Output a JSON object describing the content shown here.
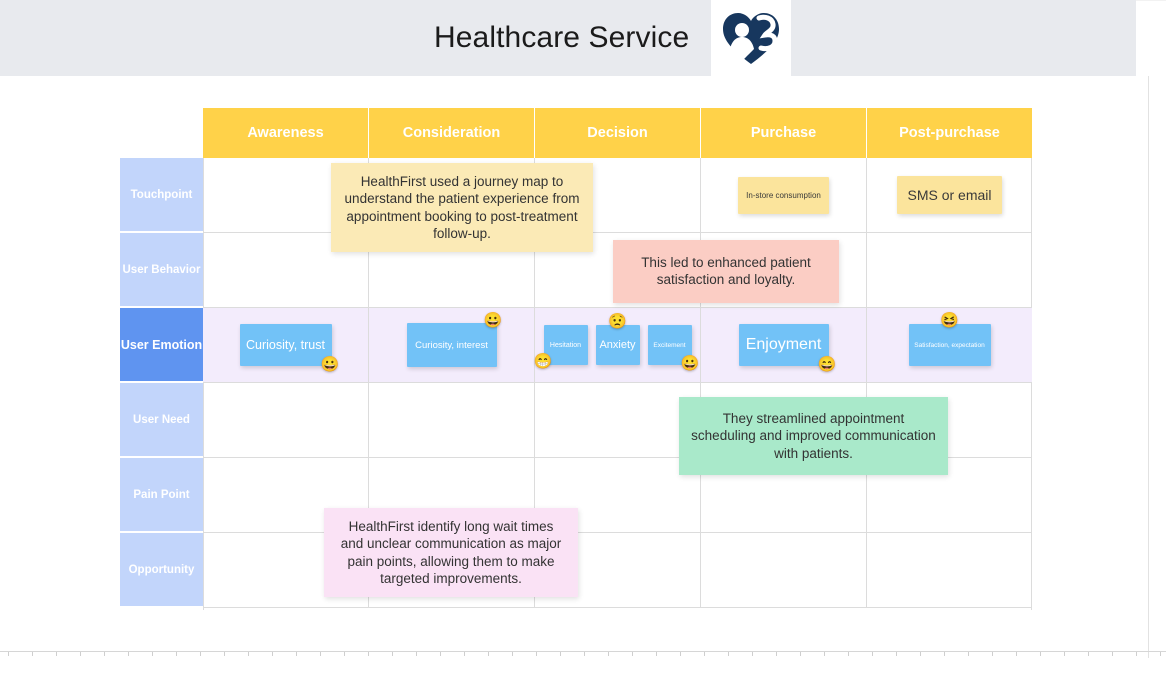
{
  "header": {
    "title": "Healthcare Service",
    "logo_icon": "heart-person-s-logo"
  },
  "journey_map": {
    "columns": [
      "Awareness",
      "Consideration",
      "Decision",
      "Purchase",
      "Post-purchase"
    ],
    "rows": [
      {
        "label": "Touchpoint"
      },
      {
        "label": "User  Behavior"
      },
      {
        "label": "User  Emotion",
        "active": true
      },
      {
        "label": "User  Need"
      },
      {
        "label": "Pain  Point"
      },
      {
        "label": "Opportunity"
      }
    ],
    "cell_notes": {
      "touchpoint_purchase": "In-store consumption",
      "touchpoint_postpurchase": "SMS  or email",
      "emotion_awareness": "Curiosity, trust",
      "emotion_consideration": "Curiosity, interest",
      "emotion_decision_1": "Hesitation",
      "emotion_decision_2": "Anxiety",
      "emotion_decision_3": "Excitement",
      "emotion_purchase": "Enjoyment",
      "emotion_postpurchase": "Satisfaction, expectation"
    },
    "emojis": {
      "emotion_awareness": "😀",
      "emotion_consideration": "😀",
      "emotion_decision_1": "😁",
      "emotion_decision_2": "😟",
      "emotion_decision_3": "😀",
      "emotion_purchase": "😄",
      "emotion_postpurchase": "😆"
    }
  },
  "overlay_notes": [
    {
      "id": "note-yellow-journey-map",
      "text": "HealthFirst used a journey map to understand the patient experience from appointment booking to post-treatment follow-up.",
      "color": "#fbeab6"
    },
    {
      "id": "note-pink-satisfaction",
      "text": "This led to enhanced patient satisfaction and loyalty.",
      "color": "#fbcdc4"
    },
    {
      "id": "note-green-streamlined",
      "text": "They streamlined appointment scheduling and improved communication with patients.",
      "color": "#a9e9ca"
    },
    {
      "id": "note-magenta-pain-points",
      "text": "HealthFirst identify long wait times and unclear communication as major pain points, allowing them to make targeted improvements.",
      "color": "#fae2f5"
    }
  ],
  "colors": {
    "header_band": "#e8eaee",
    "column_header": "#ffd249",
    "row_header": "#c2d5fb",
    "row_header_active": "#5f94f0",
    "emotion_row_bg": "#f3ecfc",
    "note_blue": "#72c2f7",
    "note_yellow": "#fbe49c",
    "logo_navy": "#17375e"
  }
}
